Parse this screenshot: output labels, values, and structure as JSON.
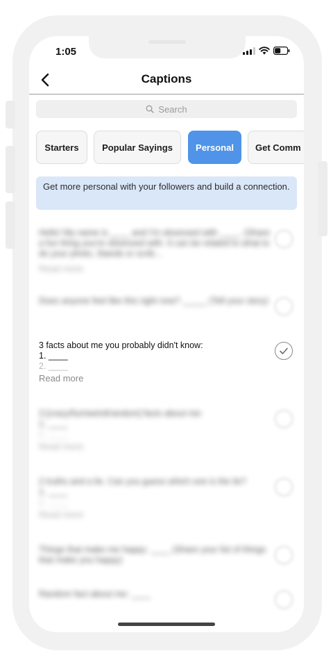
{
  "status": {
    "time": "1:05"
  },
  "nav": {
    "title": "Captions",
    "back_icon": "chevron-left-icon"
  },
  "search": {
    "placeholder": "Search",
    "icon": "search-icon"
  },
  "tabs": [
    {
      "label": "Starters",
      "active": false
    },
    {
      "label": "Popular Sayings",
      "active": false
    },
    {
      "label": "Personal",
      "active": true
    },
    {
      "label": "Get Comm",
      "active": false
    }
  ],
  "info_banner": {
    "text": "Get more personal with your followers and build a connection."
  },
  "captions": [
    {
      "text": "Hello! My name is ____ and I'm obsessed with ____. (Share a fun thing you're obsessed with. It can be related to what to do your photo, Stands or scrib…",
      "read_more": "Read more",
      "blurred": true
    },
    {
      "text": "Does anyone feel like this right now? _____ (Tell your story)",
      "read_more": "",
      "blurred": true
    },
    {
      "text": "3 facts about me you probably didn't know:",
      "line1": "1. ____",
      "line2": "2. ____",
      "read_more": "Read more",
      "blurred": false
    },
    {
      "text": "3 [crazy/fun/weird/random] facts about me:",
      "line1": "1. ____",
      "line2": "2. ____",
      "read_more": "Read more",
      "blurred": true
    },
    {
      "text": "2 truths and a lie. Can you guess which one is the lie?",
      "line1": "1. ____",
      "line2": "2. ____",
      "read_more": "Read more",
      "blurred": true
    },
    {
      "text": "Things that make me happy: ____ (Share your list of things that make you happy)",
      "read_more": "",
      "blurred": true
    },
    {
      "text": "Random fact about me: ____",
      "read_more": "",
      "blurred": true
    }
  ],
  "colors": {
    "accent": "#4f94e8",
    "info_bg": "#d9e7f8",
    "frame": "#f1f1f1"
  }
}
